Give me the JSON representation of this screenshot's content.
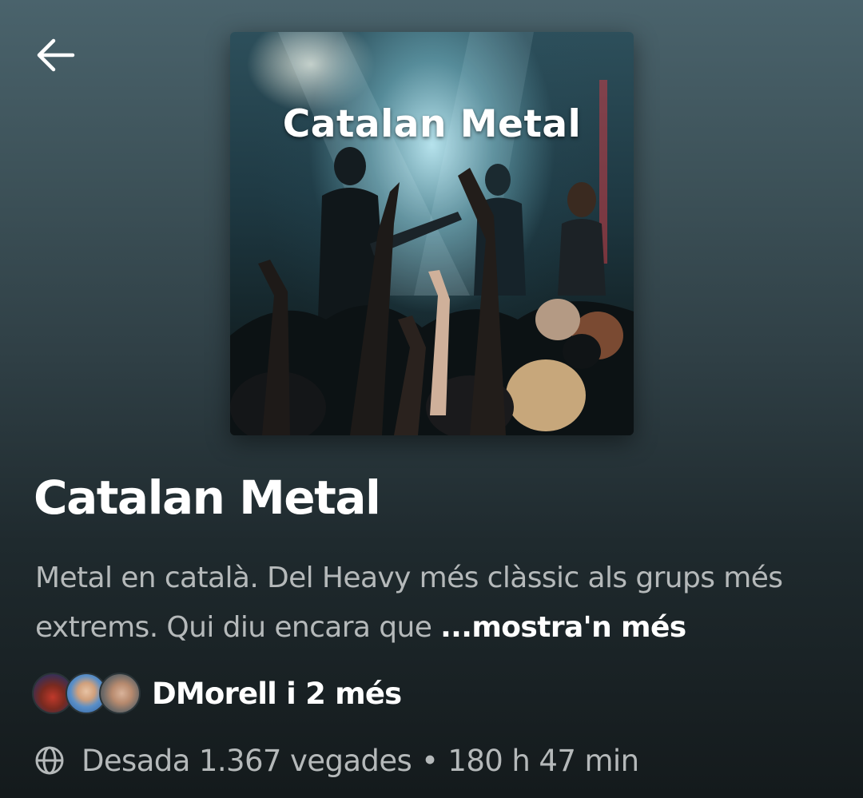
{
  "header": {
    "back_icon": "arrow-left-icon"
  },
  "cover": {
    "title_text": "Catalan Metal"
  },
  "playlist": {
    "title": "Catalan Metal",
    "description": "Metal en català. Del Heavy més clàssic als grups més extrems. Qui diu encara que ",
    "show_more_label": "...mostra'n més",
    "owners_label": "DMorell i 2 més",
    "globe_icon": "globe-icon",
    "saves_label": "Desada 1.367 vegades",
    "separator": "•",
    "duration_label": "180 h 47 min"
  },
  "colors": {
    "background_top": "#4a636c",
    "background_bottom": "#141a1c",
    "secondary_text": "#b5b9ba",
    "primary_text": "#ffffff"
  }
}
